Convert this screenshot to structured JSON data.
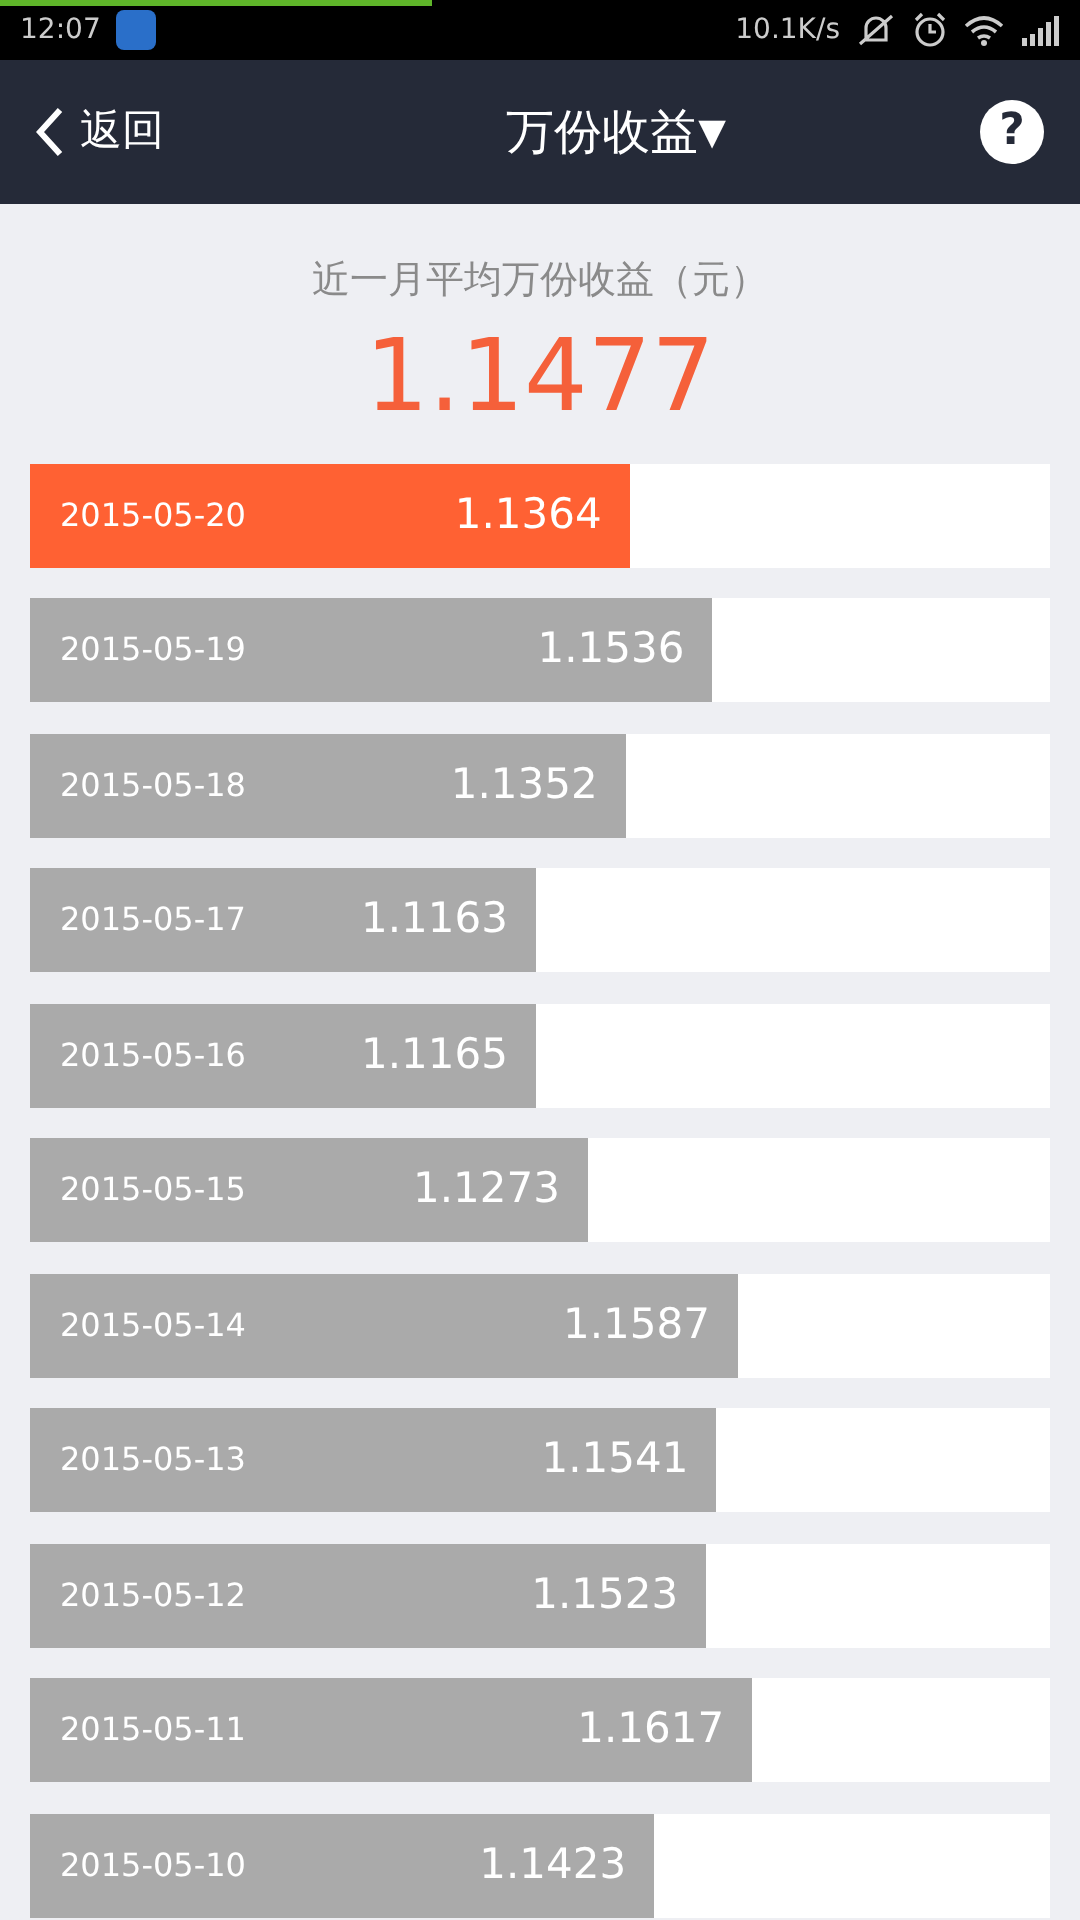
{
  "status_bar": {
    "time": "12:07",
    "speed": "10.1K/s",
    "load_progress": {
      "level": 0.4
    }
  },
  "header": {
    "back": "返回",
    "title": "万份收益",
    "title_caret": "▼",
    "help": "?"
  },
  "summary": {
    "label": "近一月平均万份收益（元）",
    "value": "1.1477"
  },
  "rows": [
    {
      "date": "2015-05-20",
      "value": "1.1364",
      "level": 0.588,
      "selected": true
    },
    {
      "date": "2015-05-19",
      "value": "1.1536",
      "level": 0.669,
      "selected": false
    },
    {
      "date": "2015-05-18",
      "value": "1.1352",
      "level": 0.584,
      "selected": false
    },
    {
      "date": "2015-05-17",
      "value": "1.1163",
      "level": 0.496,
      "selected": false
    },
    {
      "date": "2015-05-16",
      "value": "1.1165",
      "level": 0.496,
      "selected": false
    },
    {
      "date": "2015-05-15",
      "value": "1.1273",
      "level": 0.547,
      "selected": false
    },
    {
      "date": "2015-05-14",
      "value": "1.1587",
      "level": 0.694,
      "selected": false
    },
    {
      "date": "2015-05-13",
      "value": "1.1541",
      "level": 0.673,
      "selected": false
    },
    {
      "date": "2015-05-12",
      "value": "1.1523",
      "level": 0.663,
      "selected": false
    },
    {
      "date": "2015-05-11",
      "value": "1.1617",
      "level": 0.708,
      "selected": false
    },
    {
      "date": "2015-05-10",
      "value": "1.1423",
      "level": 0.612,
      "selected": false
    }
  ]
}
